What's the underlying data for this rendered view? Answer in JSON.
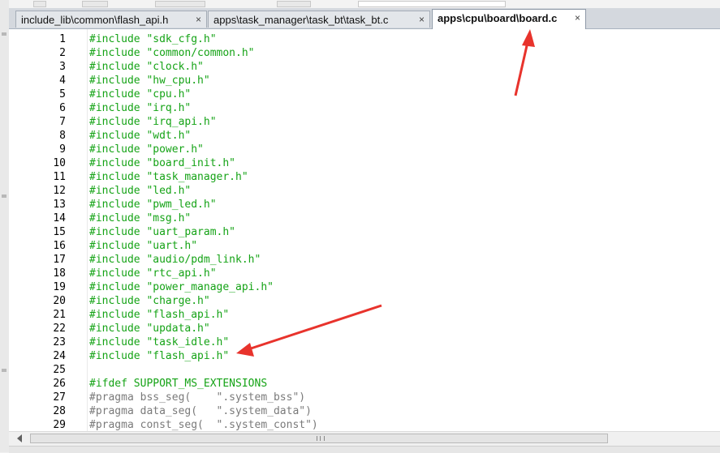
{
  "tabs": [
    {
      "label": "include_lib\\common\\flash_api.h",
      "close": "×",
      "active": false
    },
    {
      "label": "apps\\task_manager\\task_bt\\task_bt.c",
      "close": "×",
      "active": false
    },
    {
      "label": "apps\\cpu\\board\\board.c",
      "close": "×",
      "active": true
    }
  ],
  "editor": {
    "lines": [
      {
        "n": "1",
        "text": "#include \"sdk_cfg.h\"",
        "kind": "include"
      },
      {
        "n": "2",
        "text": "#include \"common/common.h\"",
        "kind": "include"
      },
      {
        "n": "3",
        "text": "#include \"clock.h\"",
        "kind": "include"
      },
      {
        "n": "4",
        "text": "#include \"hw_cpu.h\"",
        "kind": "include"
      },
      {
        "n": "5",
        "text": "#include \"cpu.h\"",
        "kind": "include"
      },
      {
        "n": "6",
        "text": "#include \"irq.h\"",
        "kind": "include"
      },
      {
        "n": "7",
        "text": "#include \"irq_api.h\"",
        "kind": "include"
      },
      {
        "n": "8",
        "text": "#include \"wdt.h\"",
        "kind": "include"
      },
      {
        "n": "9",
        "text": "#include \"power.h\"",
        "kind": "include"
      },
      {
        "n": "10",
        "text": "#include \"board_init.h\"",
        "kind": "include"
      },
      {
        "n": "11",
        "text": "#include \"task_manager.h\"",
        "kind": "include"
      },
      {
        "n": "12",
        "text": "#include \"led.h\"",
        "kind": "include"
      },
      {
        "n": "13",
        "text": "#include \"pwm_led.h\"",
        "kind": "include"
      },
      {
        "n": "14",
        "text": "#include \"msg.h\"",
        "kind": "include"
      },
      {
        "n": "15",
        "text": "#include \"uart_param.h\"",
        "kind": "include"
      },
      {
        "n": "16",
        "text": "#include \"uart.h\"",
        "kind": "include"
      },
      {
        "n": "17",
        "text": "#include \"audio/pdm_link.h\"",
        "kind": "include"
      },
      {
        "n": "18",
        "text": "#include \"rtc_api.h\"",
        "kind": "include"
      },
      {
        "n": "19",
        "text": "#include \"power_manage_api.h\"",
        "kind": "include"
      },
      {
        "n": "20",
        "text": "#include \"charge.h\"",
        "kind": "include"
      },
      {
        "n": "21",
        "text": "#include \"flash_api.h\"",
        "kind": "include"
      },
      {
        "n": "22",
        "text": "#include \"updata.h\"",
        "kind": "include"
      },
      {
        "n": "23",
        "text": "#include \"task_idle.h\"",
        "kind": "include"
      },
      {
        "n": "24",
        "text": "#include \"flash_api.h\"",
        "kind": "include"
      },
      {
        "n": "25",
        "text": "",
        "kind": "blank"
      },
      {
        "n": "26",
        "text": "#ifdef SUPPORT_MS_EXTENSIONS",
        "kind": "ifdef"
      },
      {
        "n": "27",
        "text": "#pragma bss_seg(    \".system_bss\")",
        "kind": "pragma"
      },
      {
        "n": "28",
        "text": "#pragma data_seg(   \".system_data\")",
        "kind": "pragma"
      },
      {
        "n": "29",
        "text": "#pragma const_seg(  \".system_const\")",
        "kind": "pragma"
      }
    ]
  },
  "colors": {
    "include_green": "#15a316",
    "pragma_gray": "#7a7a7a",
    "annotation_red": "#e8332c"
  },
  "icons": {
    "tab_close": "close-icon",
    "scroll_left": "arrow-left-icon",
    "scroll_grip": "grip-icon"
  }
}
